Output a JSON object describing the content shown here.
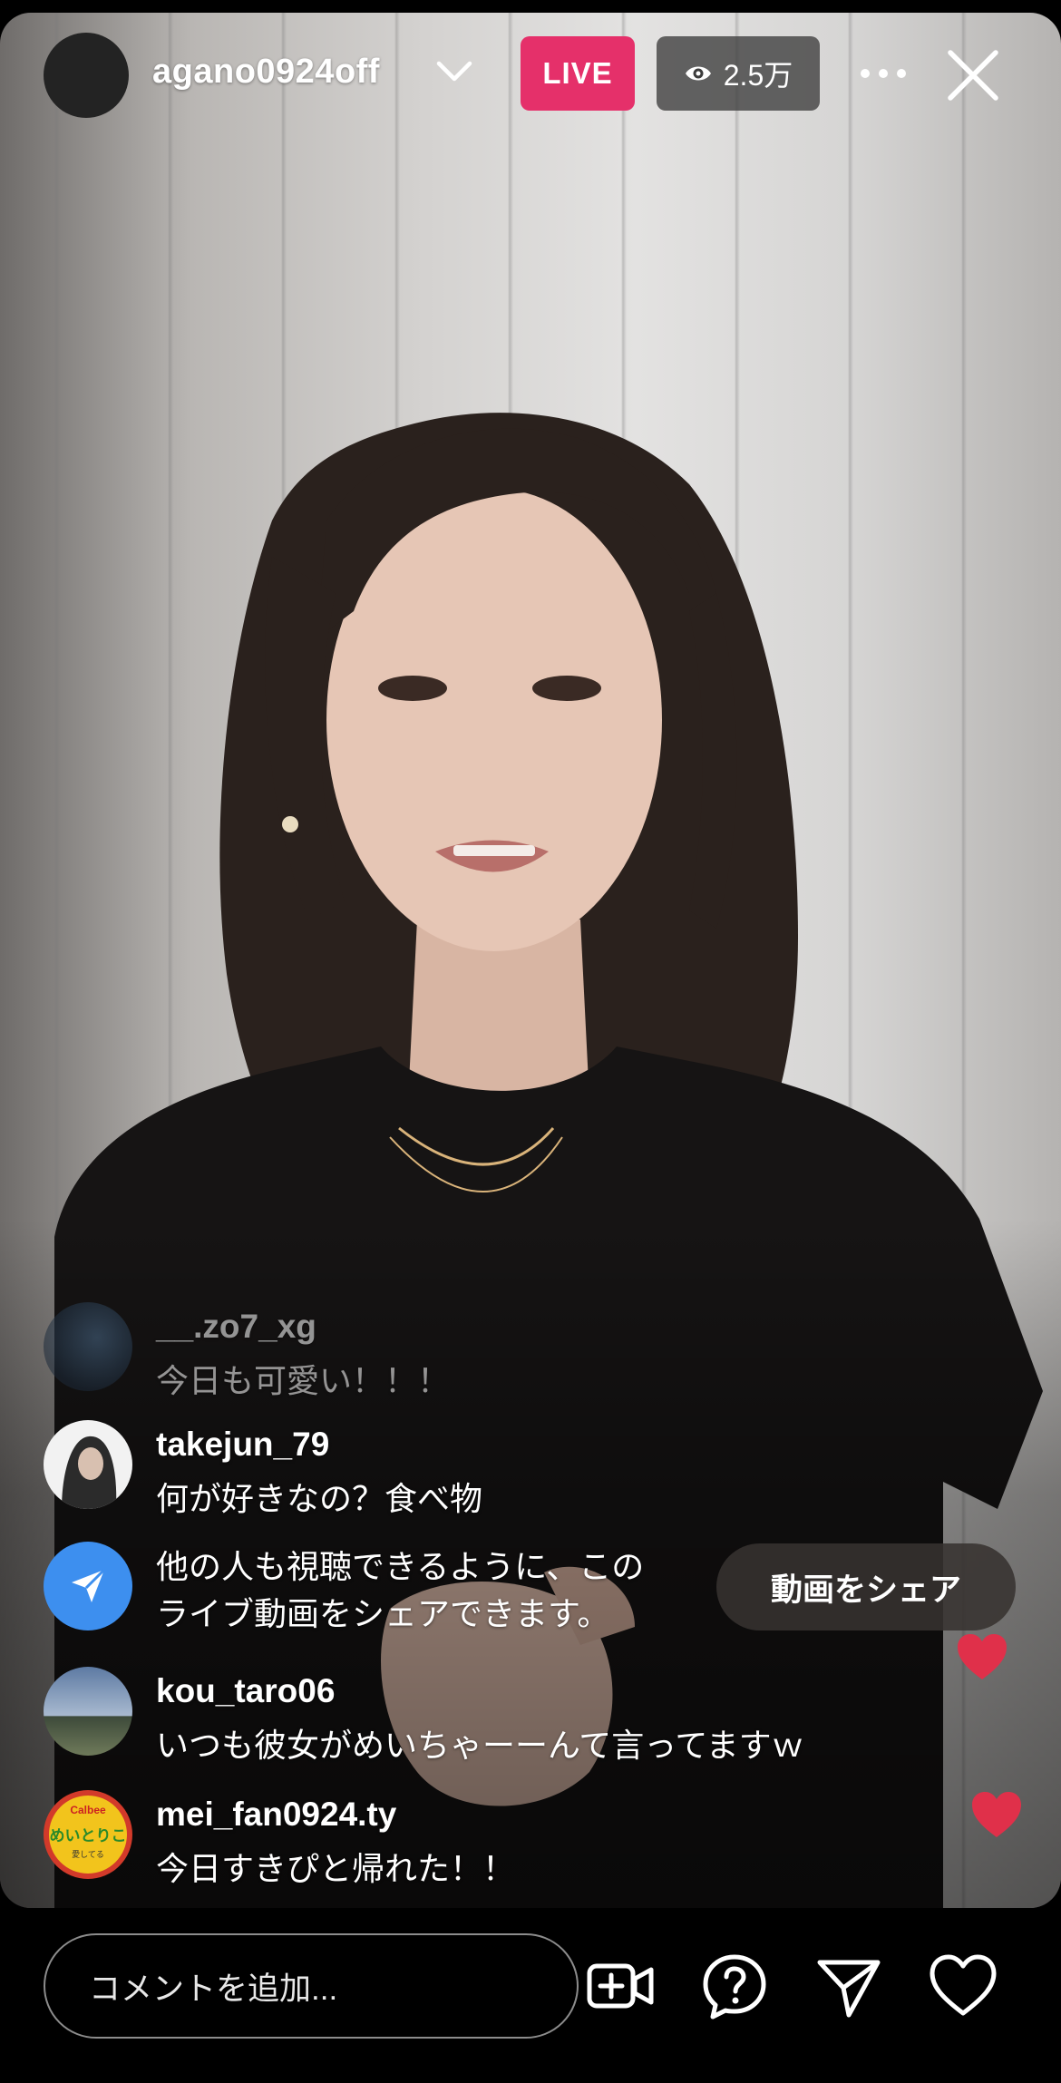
{
  "top_bar": {
    "host_username": "agano0924off",
    "live_label": "LIVE",
    "viewer_count": "2.5万"
  },
  "comments": [
    {
      "username": "__.zo7_xg",
      "text": "今日も可愛い！！！"
    },
    {
      "username": "takejun_79",
      "text": "何が好きなの？食べ物"
    },
    {
      "username": "kou_taro06",
      "text": "いつも彼女がめいちゃーーんて言ってますｗ"
    },
    {
      "username": "mei_fan0924.ty",
      "text": "今日すきぴと帰れた！！"
    }
  ],
  "share_prompt": {
    "line1": "他の人も視聴できるように、この",
    "line2": "ライブ動画をシェアできます。",
    "button_label": "動画をシェア"
  },
  "avatar_badge": {
    "brand": "Calbee",
    "title": "めいとりこ",
    "subtitle": "愛してる"
  },
  "bottom_bar": {
    "comment_placeholder": "コメントを追加..."
  },
  "icons": [
    "chevron-down-icon",
    "eye-icon",
    "more-icon",
    "close-icon",
    "send-icon",
    "heart-icon",
    "add-video-icon",
    "question-icon"
  ],
  "colors": {
    "live": "#e5306a",
    "share_blue": "#3d8fef",
    "heart": "#e0304a"
  }
}
